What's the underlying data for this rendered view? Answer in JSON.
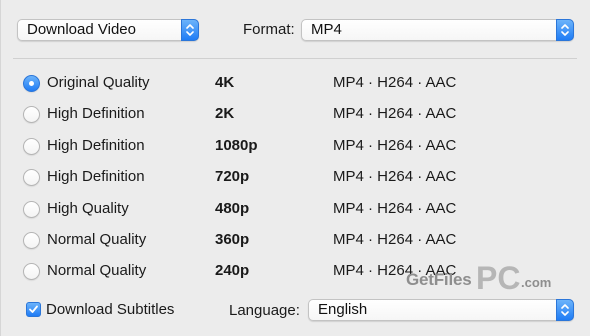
{
  "header": {
    "mode_value": "Download Video",
    "format_label": "Format:",
    "format_value": "MP4"
  },
  "qualities": [
    {
      "label": "Original Quality",
      "resolution": "4K",
      "format": "MP4 · H264 · AAC",
      "selected": true
    },
    {
      "label": "High Definition",
      "resolution": "2K",
      "format": "MP4 · H264 · AAC",
      "selected": false
    },
    {
      "label": "High Definition",
      "resolution": "1080p",
      "format": "MP4 · H264 · AAC",
      "selected": false
    },
    {
      "label": "High Definition",
      "resolution": "720p",
      "format": "MP4 · H264 · AAC",
      "selected": false
    },
    {
      "label": "High Quality",
      "resolution": "480p",
      "format": "MP4 · H264 · AAC",
      "selected": false
    },
    {
      "label": "Normal Quality",
      "resolution": "360p",
      "format": "MP4 · H264 · AAC",
      "selected": false
    },
    {
      "label": "Normal Quality",
      "resolution": "240p",
      "format": "MP4 · H264 · AAC",
      "selected": false
    }
  ],
  "footer": {
    "subtitles_label": "Download Subtitles",
    "subtitles_checked": true,
    "language_label": "Language:",
    "language_value": "English"
  },
  "watermark": {
    "text_1": "GetFiles",
    "text_2": "PC",
    "text_3": ".com"
  },
  "colors": {
    "accent": "#1f7cf5",
    "background": "#ececec"
  }
}
